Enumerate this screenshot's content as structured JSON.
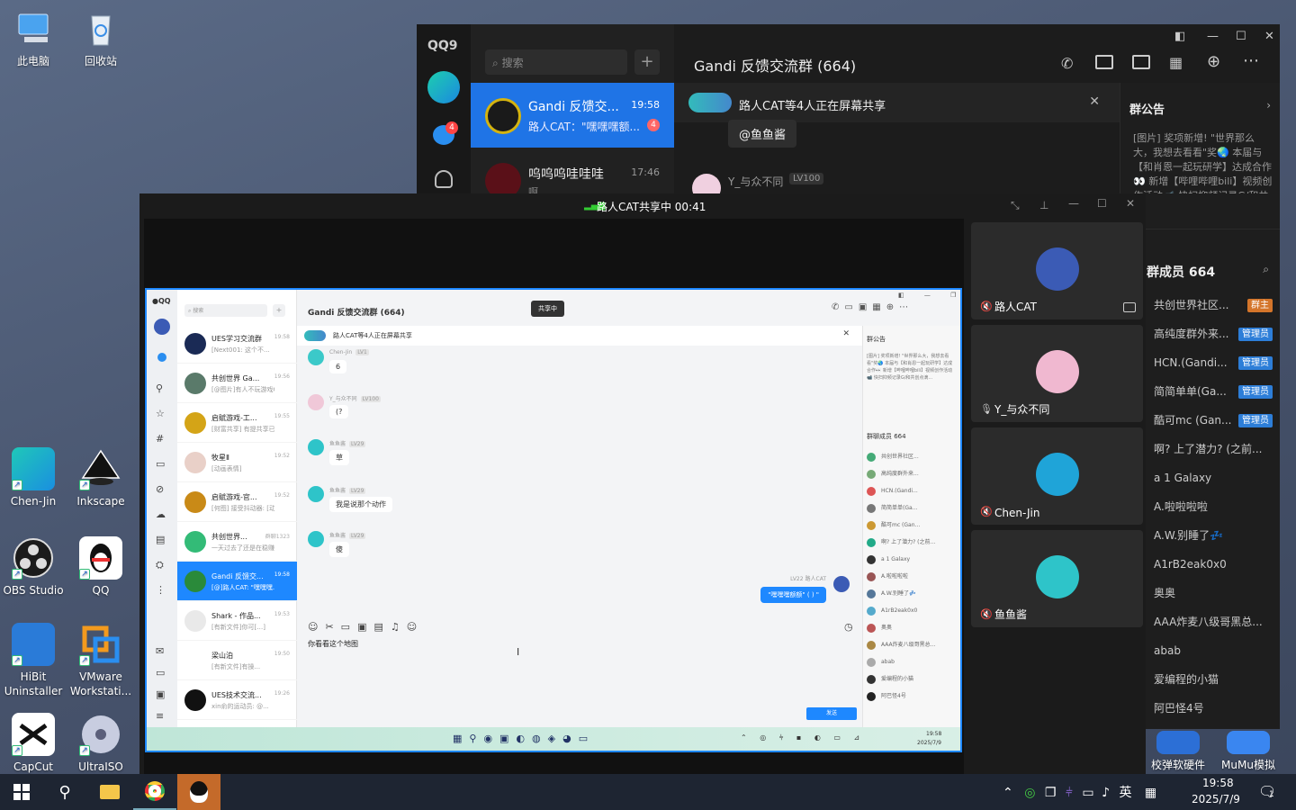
{
  "desktop": {
    "icons_top": [
      {
        "label": "此电脑"
      },
      {
        "label": "回收站"
      }
    ],
    "icons_left": [
      {
        "label": "Chen-Jin"
      },
      {
        "label": "Inkscape"
      },
      {
        "label": "OBS Studio"
      },
      {
        "label": "QQ"
      },
      {
        "label": "HiBit Uninstaller"
      },
      {
        "label": "VMware Workstati..."
      },
      {
        "label": "CapCut"
      },
      {
        "label": "UltraISO"
      }
    ],
    "icons_right": [
      {
        "label": "校弹软硬件"
      },
      {
        "label": "MuMu模拟"
      }
    ]
  },
  "qq_window": {
    "logo": "QQ9",
    "badge_count": "4",
    "search_placeholder": "搜索",
    "conversations": [
      {
        "name": "Gandi 反馈交...",
        "time": "19:58",
        "preview": "路人CAT：\"嘿嘿嘿额...",
        "unread": "4"
      },
      {
        "name": "呜呜呜哇哇哇",
        "time": "17:46",
        "preview": "啊"
      }
    ],
    "chat_title": "Gandi 反馈交流群 (664)",
    "share_banner": "路人CAT等4人正在屏幕共享",
    "mention_bubble": "@鱼鱼酱",
    "last_sender": "Y_与众不同",
    "last_sender_level": "LV100",
    "notice_title": "群公告",
    "notice_text": "[图片] 奖项新增! \"世界那么大，我想去看看\"奖🌏 本届与【和肖恩一起玩研学】达成合作👀 新增【哔哩哔哩bili】视频创作活动📹 快扫抑频记录G/和共创点滴...",
    "members_title": "群成员 664",
    "members": [
      {
        "name": "共创世界社区...",
        "role": "群主",
        "role_color": "#d4752a"
      },
      {
        "name": "高纯度群外来...",
        "role": "管理员",
        "role_color": "#2d7ed8"
      },
      {
        "name": "HCN.(Gandi...",
        "role": "管理员",
        "role_color": "#2d7ed8"
      },
      {
        "name": "简简单单(Ga...",
        "role": "管理员",
        "role_color": "#2d7ed8"
      },
      {
        "name": "酷可mc (Gan...",
        "role": "管理员",
        "role_color": "#2d7ed8"
      },
      {
        "name": "啊? 上了潜力? (之前..."
      },
      {
        "name": "a 1 Galaxy"
      },
      {
        "name": "A.啦啦啦啦"
      },
      {
        "name": "A.W.别睡了💤"
      },
      {
        "name": "A1rB2eak0x0"
      },
      {
        "name": "奥奥"
      },
      {
        "name": "AAA炸麦八级哥黑总..."
      },
      {
        "name": "abab"
      },
      {
        "name": "爱编程的小猫"
      },
      {
        "name": "阿巴怪4号"
      }
    ]
  },
  "share_window": {
    "title": "路人CAT共享中 00:41",
    "participants": [
      {
        "name": "路人CAT",
        "color": "#3b5bb5"
      },
      {
        "name": "Y_与众不同",
        "color": "#f0b8d0"
      },
      {
        "name": "Chen-Jin",
        "color": "#1fa4d8"
      },
      {
        "name": "鱼鱼酱",
        "color": "#2ec4c9"
      }
    ]
  },
  "inner_screen": {
    "search": "搜索",
    "sharing_badge": "共享中",
    "chat_title": "Gandi 反馈交流群 (664)",
    "banner": "路人CAT等4人正在屏幕共享",
    "notice_title": "群公告",
    "notice_text": "[图片] 奖项新增! \"世界那么大，我想去看看\"奖🌏 本届与【和肖恩一起玩研学】达成合作👀 新增【哔哩哔哩bili】视频创作活动📹 快扫抑频记录G/和共创点滴...",
    "members_title": "群聊成员 664",
    "input_text": "你看看这个地图",
    "send": "发送",
    "clock_time": "19:58",
    "clock_date": "2025/7/9",
    "conversations": [
      {
        "name": "UES学习交流群",
        "preview": "[Next001: 这个不...",
        "time": "19:58"
      },
      {
        "name": "共创世界 Ga...",
        "preview": "[@图片]有人不玩游戏Q...",
        "time": "19:56"
      },
      {
        "name": "启赋游戏-工...",
        "preview": "[财富共享] 有提共享已花...",
        "time": "19:55"
      },
      {
        "name": "牧星Ⅱ",
        "preview": "[动画表情]",
        "time": "19:52"
      },
      {
        "name": "启赋游戏-官...",
        "preview": "[何图] 接受抖动器: [动...",
        "time": "19:52"
      },
      {
        "name": "共创世界...",
        "preview": "一天过去了还是在稳赚...",
        "time": "群聊1323"
      },
      {
        "name": "Gandi 反馈交...",
        "preview": "[@]路人CAT: \"嘿嘿嘿...",
        "time": "19:58"
      },
      {
        "name": "Shark - 作品...",
        "preview": "[有新文件]你可[…]",
        "time": "19:53"
      },
      {
        "name": "梁山泊",
        "preview": "[有新文件]有操...",
        "time": "19:50"
      },
      {
        "name": "UES技术交流...",
        "preview": "xin俞的运动员: @...",
        "time": "19:26"
      }
    ],
    "messages": [
      {
        "name": "Chen-Jin",
        "lv": "LV1",
        "text": "6"
      },
      {
        "name": "Y_与众不同",
        "lv": "LV100",
        "text": "(?"
      },
      {
        "name": "鱼鱼酱",
        "lv": "LV29",
        "text": "草"
      },
      {
        "name": "鱼鱼酱",
        "lv": "LV29",
        "text": "我是说那个动作"
      },
      {
        "name": "鱼鱼酱",
        "lv": "LV29",
        "text": "傻"
      }
    ],
    "self_msg": {
      "name": "路人CAT",
      "lv": "LV22",
      "text": "\"嘿嘿嘿额额\" ( ) \""
    },
    "members": [
      {
        "name": "共创世界社区...",
        "color": "#4a7"
      },
      {
        "name": "高纯度群外来...",
        "color": "#7a7"
      },
      {
        "name": "HCN.(Gandi...",
        "color": "#d55"
      },
      {
        "name": "简简单单(Ga...",
        "color": "#777"
      },
      {
        "name": "酷可mc (Gan...",
        "color": "#c93"
      },
      {
        "name": "啊? 上了潜力? (之前...",
        "color": "#2a8"
      },
      {
        "name": "a 1 Galaxy",
        "color": "#333"
      },
      {
        "name": "A.啦啦啦啦",
        "color": "#955"
      },
      {
        "name": "A.W.别睡了💤",
        "color": "#579"
      },
      {
        "name": "A1rB2eak0x0",
        "color": "#5ac"
      },
      {
        "name": "奥奥",
        "color": "#b55"
      },
      {
        "name": "AAA炸麦八级哥黑总...",
        "color": "#a84"
      },
      {
        "name": "abab",
        "color": "#aaa"
      },
      {
        "name": "爱编程的小猫",
        "color": "#333"
      },
      {
        "name": "阿巴怪4号",
        "color": "#222"
      }
    ]
  },
  "taskbar": {
    "time": "19:58",
    "date": "2025/7/9",
    "ime": "英",
    "notifications": "1"
  }
}
